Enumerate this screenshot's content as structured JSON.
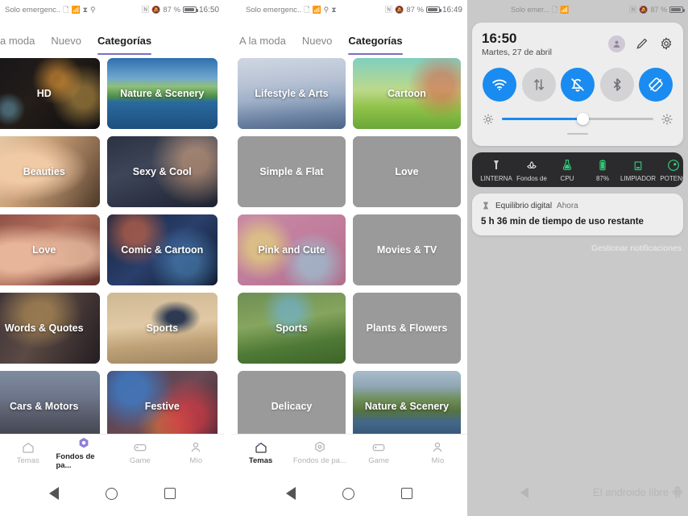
{
  "panel1": {
    "statusbar": {
      "carrier": "Solo emergenc..",
      "battery_percent": "87 %",
      "time": "16:50",
      "icons": [
        "sim-icon",
        "wifi-icon",
        "hourglass-icon",
        "nfc-icon",
        "vibrate-icon",
        "mute-icon"
      ]
    },
    "tabs": [
      {
        "label": "a moda",
        "active": false
      },
      {
        "label": "Nuevo",
        "active": false
      },
      {
        "label": "Categorías",
        "active": true
      }
    ],
    "tiles": [
      {
        "label": "HD",
        "style": "photo-hd"
      },
      {
        "label": "Nature & Scenery",
        "style": "photo-nature"
      },
      {
        "label": "Beauties",
        "style": "photo-beauties"
      },
      {
        "label": "Sexy & Cool",
        "style": "photo-sexy"
      },
      {
        "label": "Love",
        "style": "photo-love"
      },
      {
        "label": "Comic & Cartoon",
        "style": "photo-comic"
      },
      {
        "label": "Words & Quotes",
        "style": "photo-words"
      },
      {
        "label": "Sports",
        "style": "photo-sports"
      },
      {
        "label": "Cars & Motors",
        "style": "photo-cars"
      },
      {
        "label": "Festive",
        "style": "photo-festive"
      }
    ],
    "bottomnav": [
      {
        "label": "Temas",
        "icon": "home-icon",
        "active": false
      },
      {
        "label": "Fondos de pa...",
        "icon": "wallpaper-icon",
        "active": true
      },
      {
        "label": "Game",
        "icon": "gamepad-icon",
        "active": false
      },
      {
        "label": "Mío",
        "icon": "person-icon",
        "active": false
      }
    ]
  },
  "panel2": {
    "statusbar": {
      "carrier": "Solo emergenc..",
      "battery_percent": "87 %",
      "time": "16:49",
      "icons": [
        "sim-icon",
        "wifi-icon",
        "vibrate-icon",
        "hourglass-icon",
        "nfc-icon",
        "mute-icon"
      ]
    },
    "tabs": [
      {
        "label": "A la moda",
        "active": false
      },
      {
        "label": "Nuevo",
        "active": false
      },
      {
        "label": "Categorías",
        "active": true
      }
    ],
    "tiles": [
      {
        "label": "Lifestyle & Arts",
        "style": "photo-lifestyle"
      },
      {
        "label": "Cartoon",
        "style": "photo-cartoon"
      },
      {
        "label": "Simple & Flat",
        "style": "flat"
      },
      {
        "label": "Love",
        "style": "flat"
      },
      {
        "label": "Pink and Cute",
        "style": "photo-pink"
      },
      {
        "label": "Movies & TV",
        "style": "flat"
      },
      {
        "label": "Sports",
        "style": "photo-sports2"
      },
      {
        "label": "Plants & Flowers",
        "style": "flat"
      },
      {
        "label": "Delicacy",
        "style": "flat"
      },
      {
        "label": "Nature & Scenery",
        "style": "photo-nature2"
      }
    ],
    "bottomnav": [
      {
        "label": "Temas",
        "icon": "home-icon",
        "active": true
      },
      {
        "label": "Fondos de pa...",
        "icon": "wallpaper-icon",
        "active": false
      },
      {
        "label": "Game",
        "icon": "gamepad-icon",
        "active": false
      },
      {
        "label": "Mío",
        "icon": "person-icon",
        "active": false
      }
    ]
  },
  "panel3": {
    "statusbar": {
      "carrier": "Solo emer...",
      "battery_percent": "87 %",
      "icons": [
        "sim-icon",
        "wifi-icon",
        "nfc-icon",
        "mute-icon"
      ]
    },
    "quicksettings": {
      "time": "16:50",
      "date": "Martes, 27 de abril",
      "actions": [
        "avatar",
        "edit-icon",
        "gear-icon"
      ],
      "toggles": [
        {
          "name": "wifi-toggle",
          "icon": "wifi-icon",
          "on": true
        },
        {
          "name": "mobile-data-toggle",
          "icon": "data-transfer-icon",
          "on": false
        },
        {
          "name": "silent-toggle",
          "icon": "bell-off-icon",
          "on": true
        },
        {
          "name": "bluetooth-toggle",
          "icon": "bluetooth-icon",
          "on": false
        },
        {
          "name": "rotation-lock-toggle",
          "icon": "rotation-lock-icon",
          "on": true
        }
      ],
      "brightness_percent": 53
    },
    "shortcuts": [
      {
        "label": "LINTERNA",
        "icon": "flashlight-icon",
        "color": "#d8d8da"
      },
      {
        "label": "Fondos de",
        "icon": "wallpaper-lotus-icon",
        "color": "#d8d8da"
      },
      {
        "label": "CPU",
        "icon": "cpu-flask-icon",
        "color": "#2ed07a"
      },
      {
        "label": "87%",
        "icon": "battery-icon",
        "color": "#2ed07a"
      },
      {
        "label": "LIMPIADOR",
        "icon": "cleaner-icon",
        "color": "#2ed07a"
      },
      {
        "label": "POTENC",
        "icon": "power-icon",
        "color": "#2ed07a"
      }
    ],
    "notification": {
      "icon": "hourglass-icon",
      "app": "Equilibrio digital",
      "when": "Ahora",
      "body": "5 h 36 min de tiempo de uso restante"
    },
    "manage_label": "Gestionar notificaciones",
    "watermark": "El androide libre"
  },
  "colors": {
    "accent_purple": "#7b6ec4",
    "toggle_on_blue": "#1a8bf0",
    "green": "#2ed07a",
    "flat_tile_gray": "#9a9a9a",
    "shade_bg": "#c9c9c9"
  }
}
